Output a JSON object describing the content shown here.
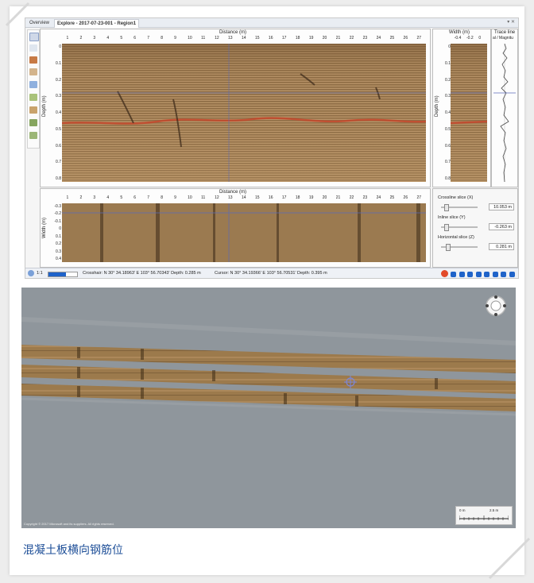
{
  "tabs": [
    {
      "label": "Overview"
    },
    {
      "label": "Explore - 2017-07-23-001 - Region1"
    }
  ],
  "window_controls": "▾ ✕",
  "tools": [
    "pointer-tool",
    "zoom-tool",
    "profile-tool",
    "pan-tool",
    "select-tool",
    "layer-tool",
    "map-tool",
    "table-tool",
    "image-tool"
  ],
  "main_panel": {
    "x_title": "Distance (m)",
    "x_ticks": [
      "1",
      "2",
      "3",
      "4",
      "5",
      "6",
      "7",
      "8",
      "9",
      "10",
      "11",
      "12",
      "13",
      "14",
      "15",
      "16",
      "17",
      "18",
      "19",
      "20",
      "21",
      "22",
      "23",
      "24",
      "25",
      "26",
      "27"
    ],
    "y_title": "Depth (m)",
    "y_ticks": [
      "0",
      "0.1",
      "0.2",
      "0.3",
      "0.4",
      "0.5",
      "0.6",
      "0.7",
      "0.8"
    ]
  },
  "width_panel": {
    "x_title": "Width (m)",
    "x_ticks": [
      "-0.4",
      "-0.2",
      "0"
    ],
    "y_title": "Depth (m)",
    "y_ticks": [
      "0",
      "0.1",
      "0.2",
      "0.3",
      "0.4",
      "0.5",
      "0.6",
      "0.7",
      "0.8"
    ]
  },
  "trace_panel": {
    "title": "Trace line",
    "subtitle": "al / Magnitu"
  },
  "bottom_panel": {
    "x_title": "Distance (m)",
    "x_ticks": [
      "1",
      "2",
      "3",
      "4",
      "5",
      "6",
      "7",
      "8",
      "9",
      "10",
      "11",
      "12",
      "13",
      "14",
      "15",
      "16",
      "17",
      "18",
      "19",
      "20",
      "21",
      "22",
      "23",
      "24",
      "25",
      "26",
      "27"
    ],
    "y_title": "Width (m)",
    "y_ticks": [
      "-0.3",
      "-0.2",
      "-0.1",
      "0",
      "0.1",
      "0.2",
      "0.3",
      "0.4"
    ]
  },
  "slices": {
    "crossline": {
      "label": "Crossline slice (X)",
      "value": "10.053 m",
      "level": 0.1
    },
    "inline": {
      "label": "Inline slice (Y)",
      "value": "-0.263 m",
      "level": 0.1
    },
    "horizontal": {
      "label": "Horizontal slice (Z)",
      "value": "0.281 m",
      "level": 0.15
    }
  },
  "status": {
    "zoom": "1:1",
    "crosshair": "Crosshair: N 30° 34.18963' E 103° 56.70343'  Depth: 0.285 m",
    "cursor": "Cursor: N 30° 34.19366' E 103° 56.70531'  Depth: 0.395 m",
    "progress": 0.6
  },
  "map": {
    "copyright": "Copyright © 2017 Microsoft and its suppliers. All rights reserved.",
    "scale_left": "0 m",
    "scale_right": "2.5 m"
  },
  "caption": "混凝土板横向钢筋位",
  "colors": {
    "radar_base": "#9d7a4e",
    "radar_band": "#c4462c",
    "accent": "#1f63c9",
    "caption": "#1e4f98"
  }
}
